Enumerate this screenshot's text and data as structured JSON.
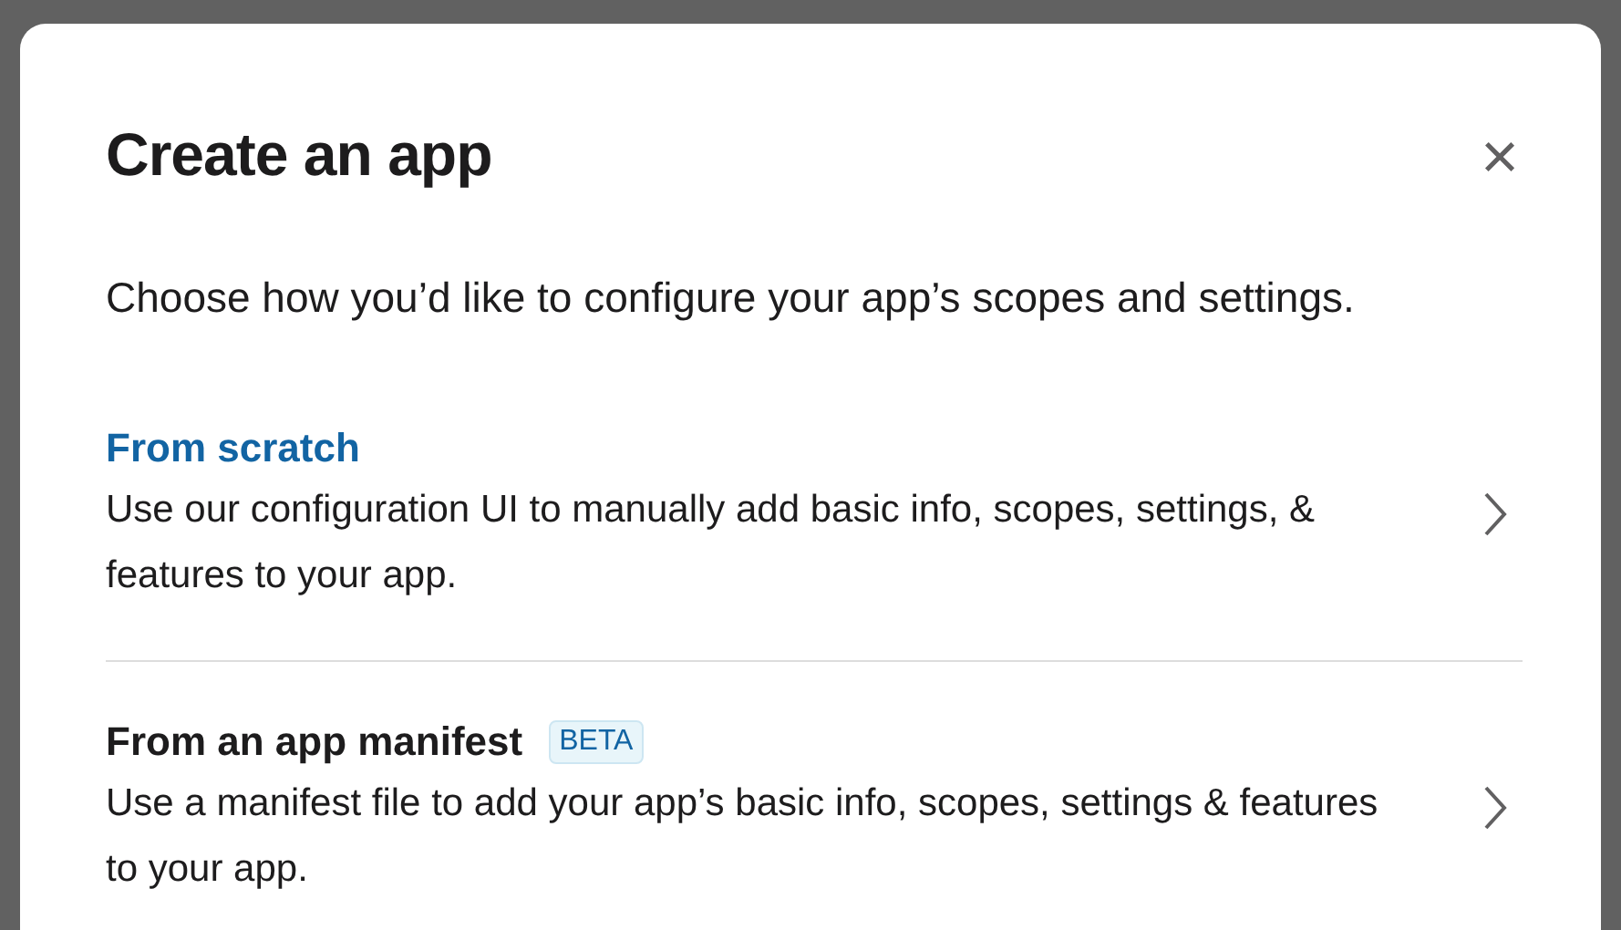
{
  "dialog": {
    "title": "Create an app",
    "close": "×",
    "description": "Choose how you’d like to configure your app’s scopes and settings.",
    "options": [
      {
        "title": "From scratch",
        "selected": true,
        "description": "Use our configuration UI to manually add basic info, scopes, settings, & features to your app."
      },
      {
        "title": "From an app manifest",
        "selected": false,
        "badge": "BETA",
        "description": "Use a manifest file to add your app’s basic info, scopes, settings & features to your app."
      }
    ]
  }
}
